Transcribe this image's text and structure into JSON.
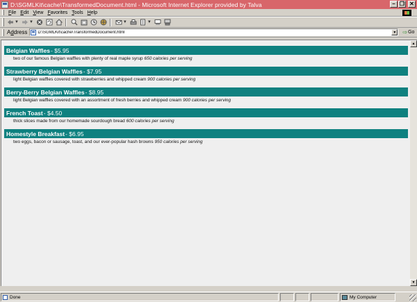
{
  "window": {
    "title": "D:\\SGMLKit\\cache\\TransformedDocument.html - Microsoft Internet Explorer provided by Talva"
  },
  "menubar": {
    "items": [
      {
        "accel": "F",
        "rest": "ile"
      },
      {
        "accel": "E",
        "rest": "dit"
      },
      {
        "accel": "V",
        "rest": "iew"
      },
      {
        "accel": "F",
        "rest": "avorites"
      },
      {
        "accel": "T",
        "rest": "ools"
      },
      {
        "accel": "H",
        "rest": "elp"
      }
    ]
  },
  "addressbar": {
    "label_accel": "d",
    "label_pre": "A",
    "label_post": "dress",
    "value": "D:\\SGMLKit\\cache\\TransformedDocument.html",
    "go_label": "Go"
  },
  "menu": [
    {
      "name": "Belgian Waffles",
      "price": " - $5.95",
      "description": "two of our famous Belgian waffles with plenty of real maple syrup ",
      "calories": "650 calories per serving"
    },
    {
      "name": "Strawberry Belgian Waffles",
      "price": " - $7.95",
      "description": "light Belgian waffles covered with strawberries and whipped cream ",
      "calories": "900 calories per serving"
    },
    {
      "name": "Berry-Berry Belgian Waffles",
      "price": " - $8.95",
      "description": "light Belgian waffles covered with an assortment of fresh berries and whipped cream ",
      "calories": "900 calories per serving"
    },
    {
      "name": "French Toast",
      "price": " - $4.50",
      "description": "thick slices made from our homemade sourdough bread ",
      "calories": "600 calories per serving"
    },
    {
      "name": "Homestyle Breakfast",
      "price": " - $6.95",
      "description": "two eggs, bacon or sausage, toast, and our ever-popular hash browns ",
      "calories": "950 calories per serving"
    }
  ],
  "statusbar": {
    "status": "Done",
    "zone": "My Computer"
  },
  "colors": {
    "item_header_bg": "#0f8180",
    "titlebar_bg": "#d8666a",
    "content_bg": "#efefef"
  }
}
